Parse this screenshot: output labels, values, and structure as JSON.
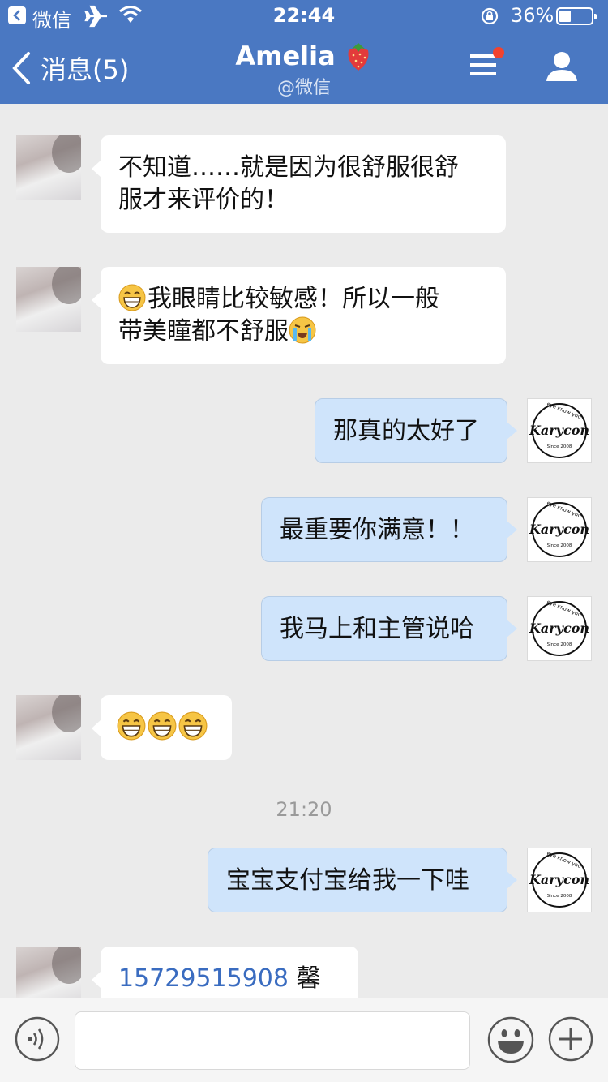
{
  "status_bar": {
    "back_app_label": "微信",
    "time": "22:44",
    "battery_percent": "36%",
    "battery_level": 0.36
  },
  "header": {
    "back_label": "消息(5)",
    "title": "Amelia",
    "subtitle": "@微信"
  },
  "avatar_logo": {
    "brand": "Karycon",
    "tagline": "eye know you",
    "since": "Since 2008"
  },
  "messages": [
    {
      "from": "contact",
      "lines": [
        "不知道……就是因为很舒服很舒",
        "服才来评价的！"
      ]
    },
    {
      "from": "contact",
      "line1_text": "我眼睛比较敏感！所以一般",
      "line2_text": "带美瞳都不舒服",
      "emojis": [
        "grin-emoji",
        "crying-emoji"
      ]
    },
    {
      "from": "me",
      "text": "那真的太好了"
    },
    {
      "from": "me",
      "text": "最重要你满意！！"
    },
    {
      "from": "me",
      "text": "我马上和主管说哈"
    },
    {
      "from": "contact",
      "emojis": [
        "grin-emoji",
        "grin-emoji",
        "grin-emoji"
      ]
    },
    {
      "from": "me",
      "text": "宝宝支付宝给我一下哇"
    },
    {
      "from": "contact",
      "phone": "15729515908",
      "name": "馨月"
    }
  ],
  "time_separator": "21:20",
  "input": {
    "placeholder": ""
  },
  "colors": {
    "nav": "#4a78c2",
    "outgoing_bubble": "#cfe4fb",
    "incoming_bubble": "#ffffff",
    "link": "#3a6cc0",
    "badge": "#f2432e"
  }
}
